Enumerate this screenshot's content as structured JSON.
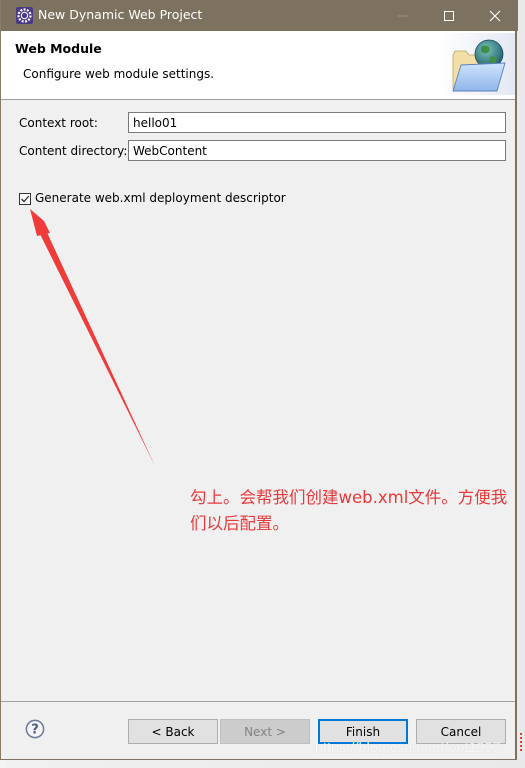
{
  "window": {
    "title": "New Dynamic Web Project",
    "controls": {
      "minimize": "minimize",
      "maximize": "maximize",
      "close": "close"
    }
  },
  "header": {
    "title": "Web Module",
    "description": "Configure web module settings.",
    "banner_icon": "folder-globe-icon"
  },
  "form": {
    "context_root": {
      "label": "Context root:",
      "value": "hello01"
    },
    "content_directory": {
      "label": "Content directory:",
      "value": "WebContent"
    },
    "generate_descriptor": {
      "label": "Generate web.xml deployment descriptor",
      "checked": true
    }
  },
  "annotation": {
    "text": "勾上。会帮我们创建web.xml文件。方便我们以后配置。",
    "color": "#e8393b"
  },
  "footer": {
    "help_icon": "question-circle-icon",
    "buttons": {
      "back": "< Back",
      "next": "Next >",
      "finish": "Finish",
      "cancel": "Cancel"
    }
  },
  "watermark": "https://blog.csdn.net/opt1997",
  "colors": {
    "titlebar": "#7d7260",
    "focus_border": "#0078d7",
    "annotation_red": "#e8393b"
  }
}
